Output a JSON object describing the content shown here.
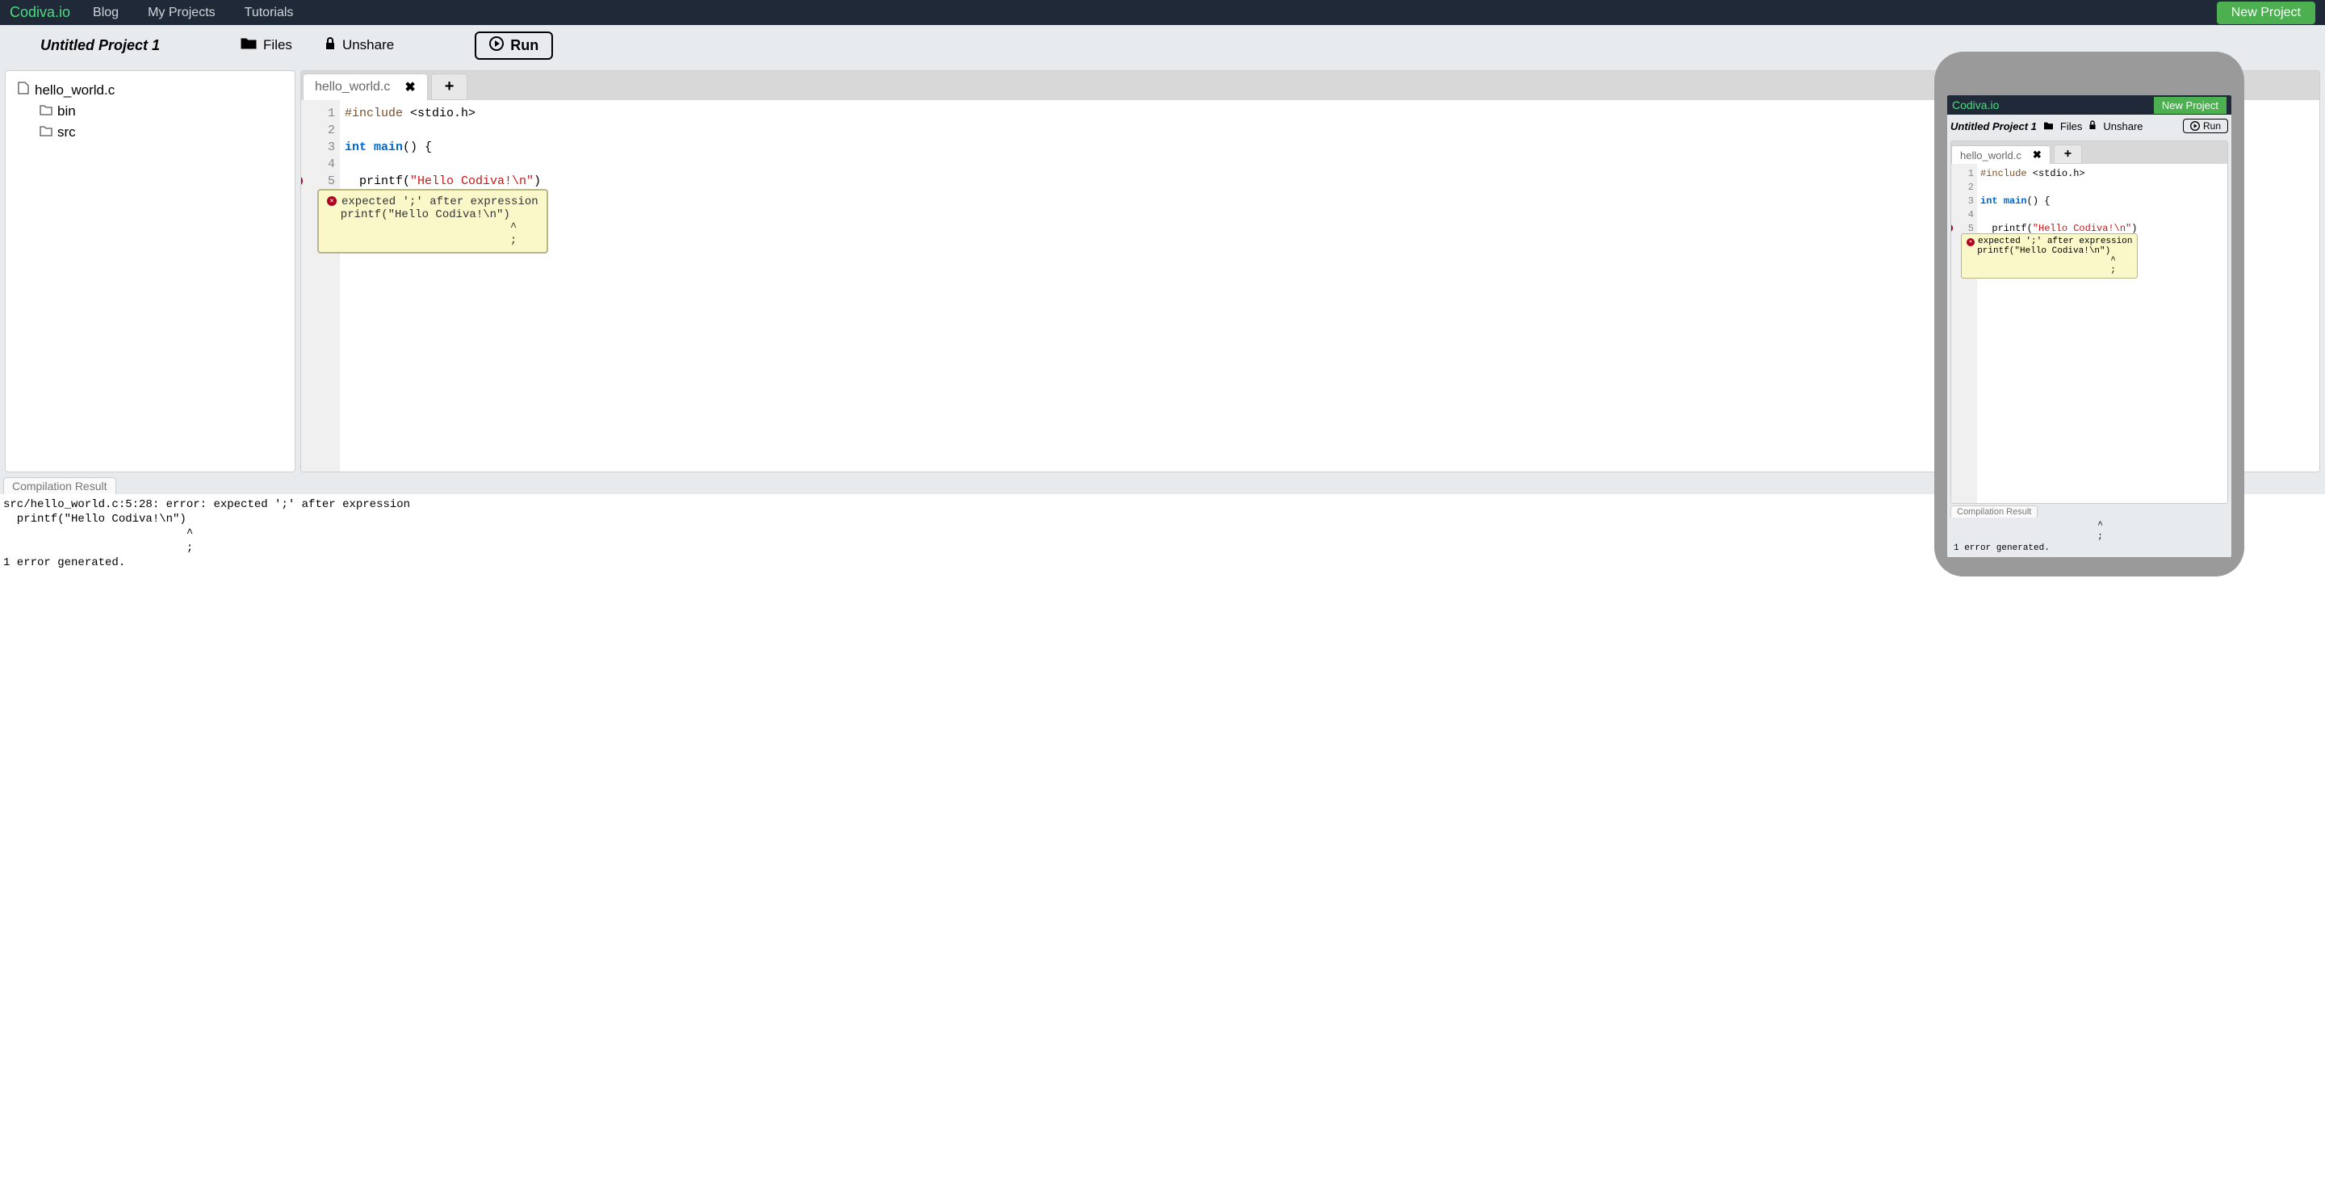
{
  "nav": {
    "logo": "Codiva.io",
    "links": [
      "Blog",
      "My Projects",
      "Tutorials"
    ],
    "new_project": "New Project"
  },
  "toolbar": {
    "project_title": "Untitled Project 1",
    "files": "Files",
    "unshare": "Unshare",
    "run": "Run"
  },
  "file_tree": {
    "root": "hello_world.c",
    "folders": [
      "bin",
      "src"
    ]
  },
  "editor": {
    "tab_name": "hello_world.c",
    "lines": [
      {
        "n": 1,
        "raw": "#include <stdio.h>"
      },
      {
        "n": 2,
        "raw": ""
      },
      {
        "n": 3,
        "raw": "int main() {"
      },
      {
        "n": 4,
        "raw": ""
      },
      {
        "n": 5,
        "raw": "  printf(\"Hello Codiva!\\n\")",
        "error": true
      }
    ],
    "error_tooltip": "expected ';' after expression\n  printf(\"Hello Codiva!\\n\")\n                           ^\n                           ;"
  },
  "compilation": {
    "tab": "Compilation Result",
    "output": "src/hello_world.c:5:28: error: expected ';' after expression\n  printf(\"Hello Codiva!\\n\")\n                           ^\n                           ;\n1 error generated."
  },
  "mobile": {
    "comp_output": "                           ^\n                           ;\n1 error generated."
  }
}
